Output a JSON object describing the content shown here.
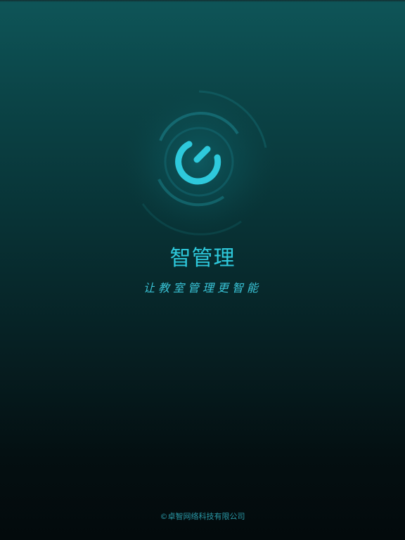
{
  "app": {
    "title": "智管理",
    "slogan": "让教室管理更智能",
    "copyright": "©卓智网络科技有限公司"
  },
  "logo": {
    "icon": "power-ring-icon",
    "accent_color": "#2ec9dc"
  },
  "colors": {
    "background_top": "#0e5558",
    "background_bottom": "#030a0c",
    "accent": "#2ec9dc"
  }
}
